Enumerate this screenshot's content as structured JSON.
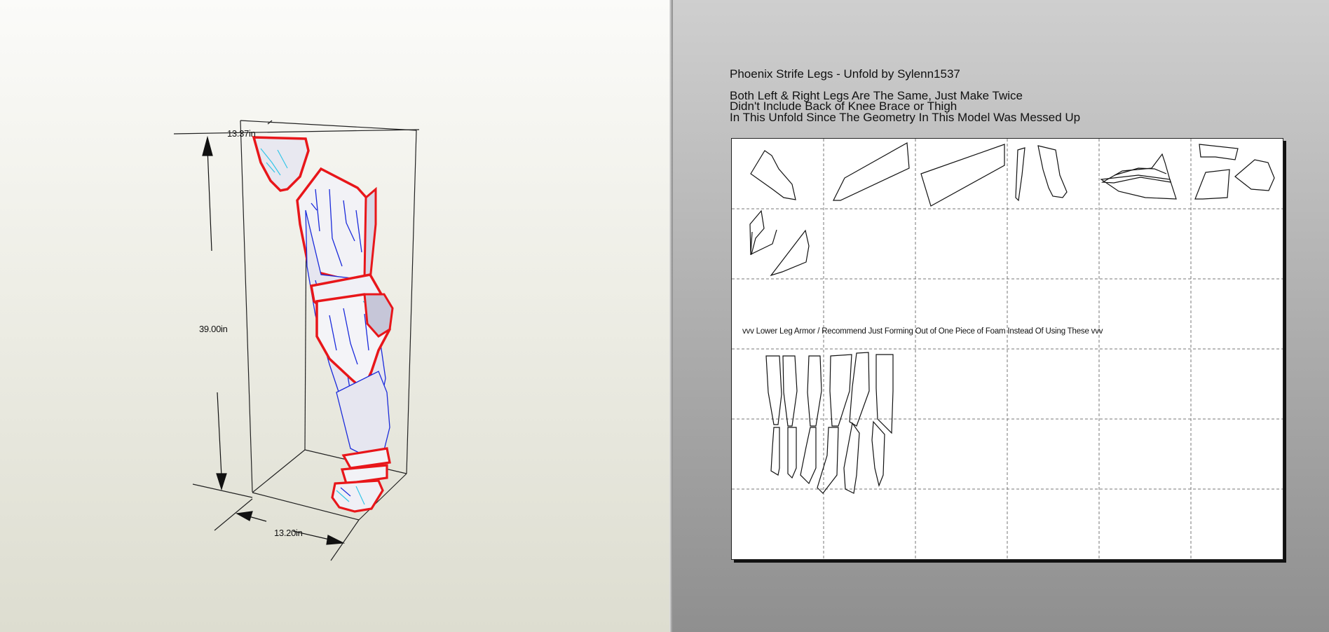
{
  "model_view": {
    "dimensions": {
      "width": "13.37in",
      "height": "39.00in",
      "depth": "13.20in"
    }
  },
  "pattern_view": {
    "title": "Phoenix Strife Legs - Unfold by Sylenn1537",
    "notes": [
      "Both Left & Right Legs Are The Same, Just Make Twice",
      "Didn't Include Back of Knee Brace or Thigh",
      "In This Unfold Since The Geometry In This Model Was Messed Up"
    ],
    "sheet_label": "vvv Lower Leg Armor / Recommend Just Forming Out of One Piece of Foam Instead Of Using These vvv",
    "page_grid": {
      "columns": 6,
      "rows": 6
    }
  },
  "colors": {
    "outline_red": "#e8161a",
    "edge_blue": "#1b2bdb",
    "edge_cyan": "#34c6e8",
    "piece_stroke": "#111111"
  }
}
